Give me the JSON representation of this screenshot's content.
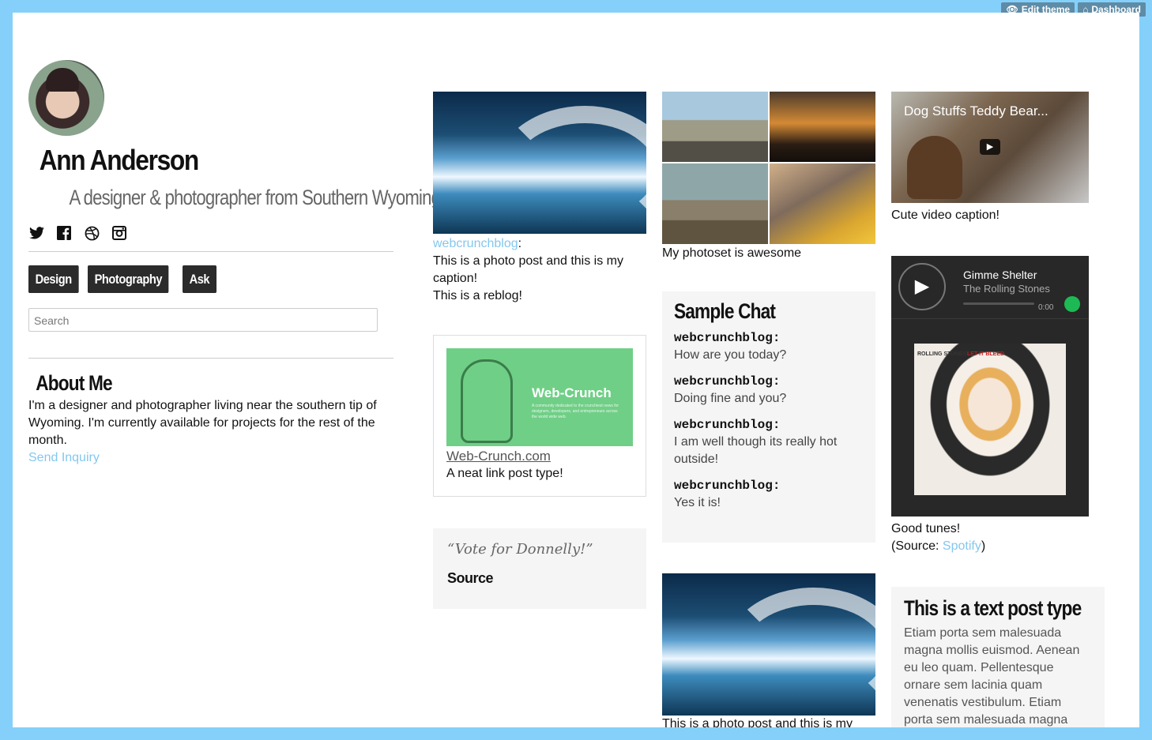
{
  "topbar": {
    "edit_theme": "Edit theme",
    "dashboard": "Dashboard"
  },
  "profile": {
    "name": "Ann Anderson",
    "tagline": "A designer & photographer from Southern Wyoming",
    "social_icons": [
      "twitter-icon",
      "facebook-icon",
      "dribbble-icon",
      "instagram-icon"
    ]
  },
  "nav": {
    "items": [
      "Design",
      "Photography",
      "Ask"
    ]
  },
  "search": {
    "placeholder": "Search"
  },
  "about": {
    "heading": "About Me",
    "text": "I'm a designer and photographer living near the southern tip of Wyoming. I'm currently available for projects for the rest of the month.",
    "link": "Send Inquiry"
  },
  "posts": {
    "photo1": {
      "reblog_user": "webcrunchblog",
      "caption": "This is a photo post and this is my caption!",
      "reblog": "This is a reblog!"
    },
    "link_post": {
      "brand": "Web-Crunch",
      "blurb": "A community dedicated to the crunchiest news for designers, developers, and entrepreneurs across the world wide web.",
      "url_text": "Web-Crunch.com",
      "desc": "A neat link post type!"
    },
    "quote": {
      "text": "“Vote for Donnelly!”",
      "source": "Source"
    },
    "photoset": {
      "caption": "My photoset is awesome"
    },
    "chat": {
      "title": "Sample Chat",
      "lines": [
        {
          "name": "webcrunchblog:",
          "text": "How are you today?"
        },
        {
          "name": "webcrunchblog:",
          "text": "Doing fine and you?"
        },
        {
          "name": "webcrunchblog:",
          "text": "I am well though its really hot outside!"
        },
        {
          "name": "webcrunchblog:",
          "text": "Yes it is!"
        }
      ]
    },
    "photo2": {
      "caption": "This is a photo post and this is my"
    },
    "video": {
      "title": "Dog Stuffs Teddy Bear...",
      "caption": "Cute video caption!"
    },
    "audio": {
      "track": "Gimme Shelter",
      "artist": "The Rolling Stones",
      "time": "0:00",
      "album_label_left": "ROLLING STONES",
      "album_label_right": "LET IT BLEED",
      "caption": "Good tunes!",
      "source_prefix": "(Source: ",
      "source_link": "Spotify",
      "source_suffix": ")"
    },
    "text_post": {
      "title": "This is a text post type",
      "body": "Etiam porta sem malesuada magna mollis euismod. Aenean eu leo quam. Pellentesque ornare sem lacinia quam venenatis vestibulum. Etiam porta sem malesuada magna"
    }
  },
  "colors": {
    "frame": "#84d0fb",
    "link": "#84c7ef",
    "button": "#2b2b2b",
    "spotify_green": "#1db954"
  }
}
